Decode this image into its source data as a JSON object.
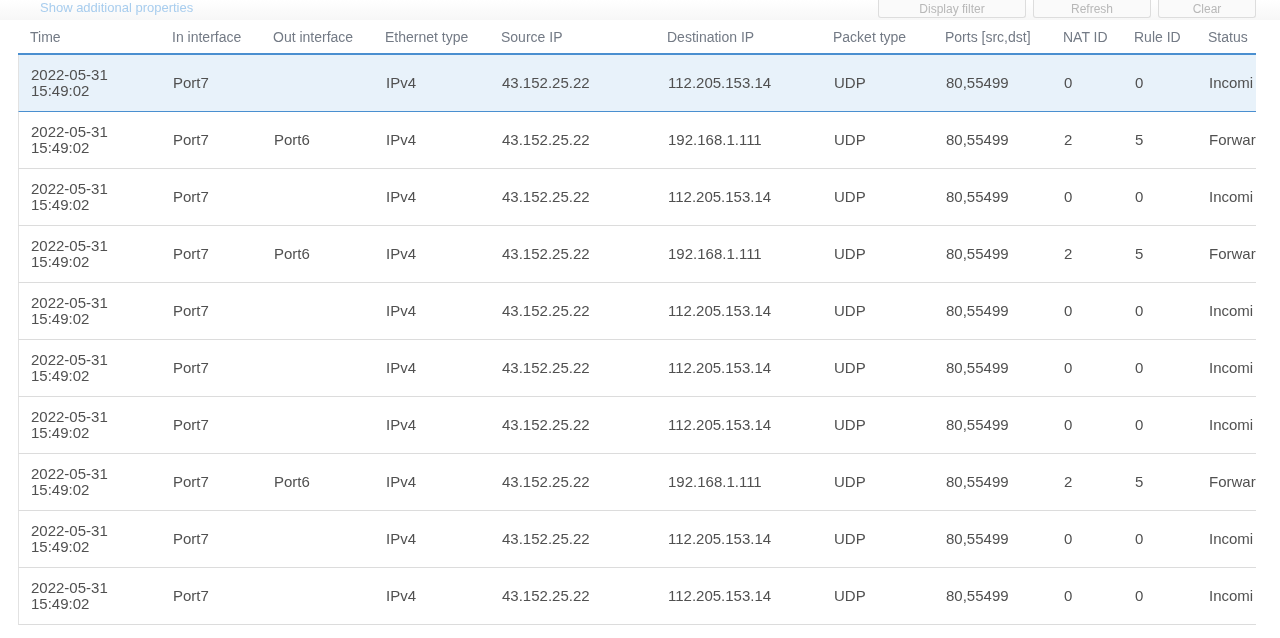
{
  "link": "Show additional properties",
  "buttons": [
    "Display filter",
    "Refresh",
    "Clear"
  ],
  "table": {
    "columns": [
      "Time",
      "In interface",
      "Out interface",
      "Ethernet type",
      "Source IP",
      "Destination IP",
      "Packet type",
      "Ports [src,dst]",
      "NAT ID",
      "Rule ID",
      "Status"
    ],
    "rows": [
      {
        "selected": true,
        "cells": [
          "2022-05-31 15:49:02",
          "Port7",
          "",
          "IPv4",
          "43.152.25.22",
          "112.205.153.14",
          "UDP",
          "80,55499",
          "0",
          "0",
          "Incomi"
        ]
      },
      {
        "selected": false,
        "cells": [
          "2022-05-31 15:49:02",
          "Port7",
          "Port6",
          "IPv4",
          "43.152.25.22",
          "192.168.1.111",
          "UDP",
          "80,55499",
          "2",
          "5",
          "Forwar"
        ]
      },
      {
        "selected": false,
        "cells": [
          "2022-05-31 15:49:02",
          "Port7",
          "",
          "IPv4",
          "43.152.25.22",
          "112.205.153.14",
          "UDP",
          "80,55499",
          "0",
          "0",
          "Incomi"
        ]
      },
      {
        "selected": false,
        "cells": [
          "2022-05-31 15:49:02",
          "Port7",
          "Port6",
          "IPv4",
          "43.152.25.22",
          "192.168.1.111",
          "UDP",
          "80,55499",
          "2",
          "5",
          "Forwar"
        ]
      },
      {
        "selected": false,
        "cells": [
          "2022-05-31 15:49:02",
          "Port7",
          "",
          "IPv4",
          "43.152.25.22",
          "112.205.153.14",
          "UDP",
          "80,55499",
          "0",
          "0",
          "Incomi"
        ]
      },
      {
        "selected": false,
        "cells": [
          "2022-05-31 15:49:02",
          "Port7",
          "",
          "IPv4",
          "43.152.25.22",
          "112.205.153.14",
          "UDP",
          "80,55499",
          "0",
          "0",
          "Incomi"
        ]
      },
      {
        "selected": false,
        "cells": [
          "2022-05-31 15:49:02",
          "Port7",
          "",
          "IPv4",
          "43.152.25.22",
          "112.205.153.14",
          "UDP",
          "80,55499",
          "0",
          "0",
          "Incomi"
        ]
      },
      {
        "selected": false,
        "cells": [
          "2022-05-31 15:49:02",
          "Port7",
          "Port6",
          "IPv4",
          "43.152.25.22",
          "192.168.1.111",
          "UDP",
          "80,55499",
          "2",
          "5",
          "Forwar"
        ]
      },
      {
        "selected": false,
        "cells": [
          "2022-05-31 15:49:02",
          "Port7",
          "",
          "IPv4",
          "43.152.25.22",
          "112.205.153.14",
          "UDP",
          "80,55499",
          "0",
          "0",
          "Incomi"
        ]
      },
      {
        "selected": false,
        "cells": [
          "2022-05-31 15:49:02",
          "Port7",
          "",
          "IPv4",
          "43.152.25.22",
          "112.205.153.14",
          "UDP",
          "80,55499",
          "0",
          "0",
          "Incomi"
        ]
      }
    ]
  }
}
